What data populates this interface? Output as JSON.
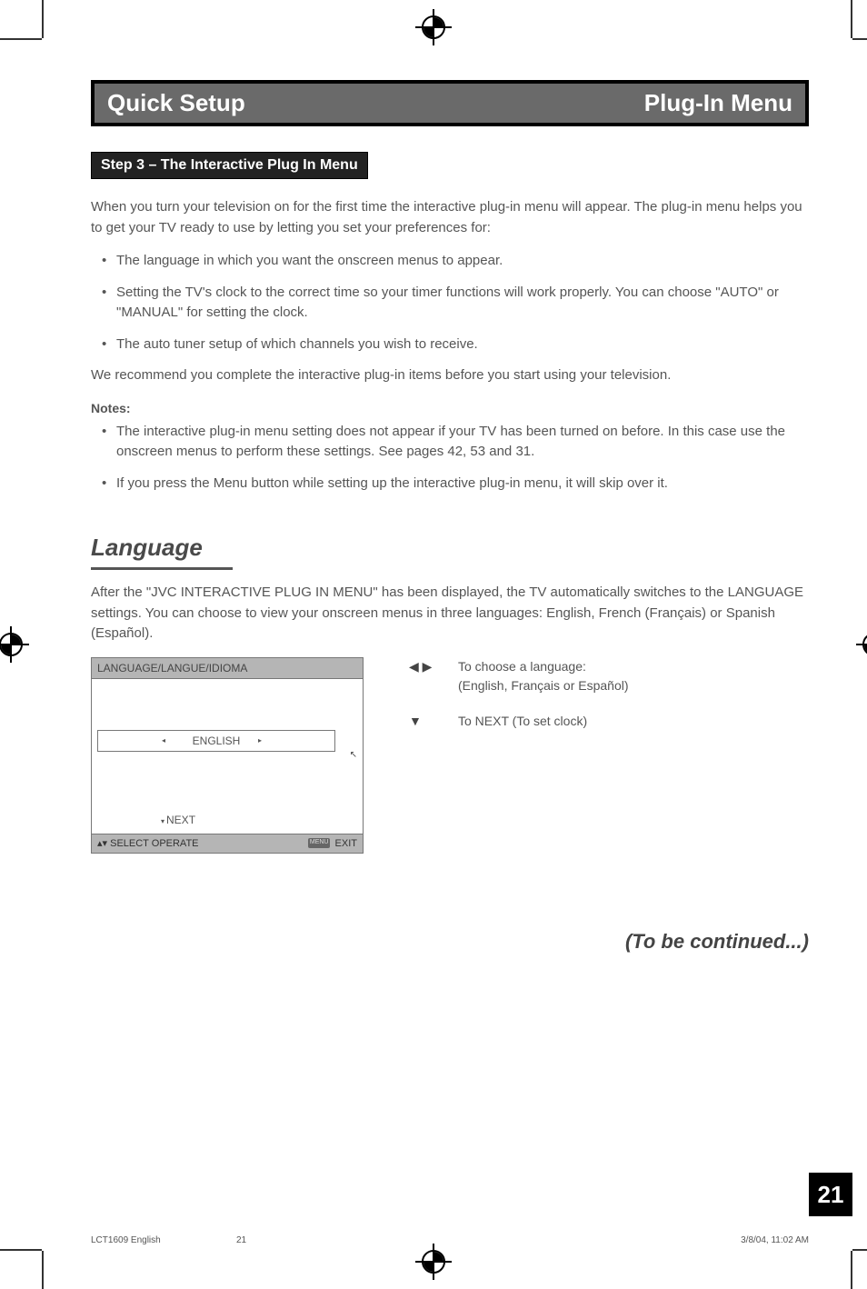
{
  "header": {
    "left_title": "Quick Setup",
    "right_title": "Plug-In Menu"
  },
  "step_bar": "Step 3 – The Interactive Plug In Menu",
  "intro": "When you turn your television on for the first time the interactive plug-in menu will appear.  The plug-in menu helps you to get your TV ready to use by letting you set your preferences for:",
  "bullets_main": [
    "The language in which you want the onscreen menus to appear.",
    "Setting the TV's clock to the correct time so your timer functions will work properly. You can choose \"AUTO\" or \"MANUAL\" for setting the clock.",
    "The auto tuner setup of which channels you wish to receive."
  ],
  "recommend": "We recommend you complete the interactive plug-in items before you start using your television.",
  "notes_label": "Notes:",
  "bullets_notes": [
    "The interactive plug-in menu setting does not appear if your TV has been turned on before.  In this case use the onscreen menus to perform these settings.  See pages 42, 53 and 31.",
    "If you press the Menu button while setting up the interactive plug-in menu, it will skip over it."
  ],
  "language": {
    "title": "Language",
    "intro": "After the \"JVC INTERACTIVE PLUG IN MENU\" has been displayed, the TV automatically switches to the LANGUAGE settings. You can choose to view your onscreen menus in three languages:  English, French (Français) or Spanish (Español)."
  },
  "osd": {
    "header": "LANGUAGE/LANGUE/IDIOMA",
    "field_value": "ENGLISH",
    "next_label": "NEXT",
    "footer_left": "SELECT   OPERATE",
    "footer_menu_badge": "MENU",
    "footer_right": "EXIT"
  },
  "controls": [
    {
      "symbol": "◀ ▶",
      "text_line1": "To choose a language:",
      "text_line2": "(English, Français or Español)"
    },
    {
      "symbol": "▼",
      "text_line1": "To NEXT (To set clock)",
      "text_line2": ""
    }
  ],
  "tbc": "(To be continued...)",
  "page_number": "21",
  "footer": {
    "doc": "LCT1609 English",
    "page": "21",
    "datetime": "3/8/04, 11:02 AM"
  }
}
